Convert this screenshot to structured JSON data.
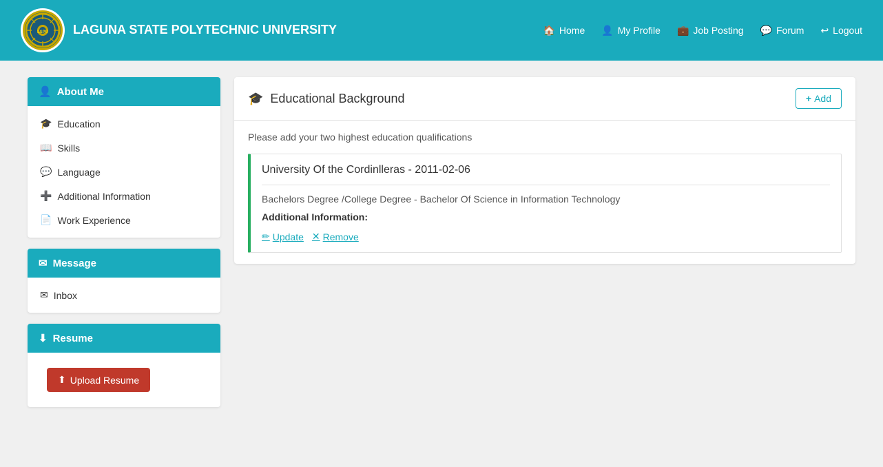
{
  "header": {
    "university_name": "LAGUNA STATE POLYTECHNIC UNIVERSITY",
    "nav": {
      "home": "Home",
      "my_profile": "My Profile",
      "job_posting": "Job Posting",
      "forum": "Forum",
      "logout": "Logout"
    }
  },
  "sidebar": {
    "about_me": {
      "label": "About Me",
      "items": [
        {
          "id": "education",
          "label": "Education",
          "icon": "grad-cap"
        },
        {
          "id": "skills",
          "label": "Skills",
          "icon": "book"
        },
        {
          "id": "language",
          "label": "Language",
          "icon": "chat"
        },
        {
          "id": "additional-info",
          "label": "Additional Information",
          "icon": "plus-icon"
        },
        {
          "id": "work-experience",
          "label": "Work Experience",
          "icon": "file-icon"
        }
      ]
    },
    "message": {
      "label": "Message",
      "items": [
        {
          "id": "inbox",
          "label": "Inbox",
          "icon": "envelope"
        }
      ]
    },
    "resume": {
      "label": "Resume",
      "upload_btn_label": "Upload Resume"
    }
  },
  "main": {
    "section_title": "Educational Background",
    "add_button": "Add",
    "info_text": "Please add your two highest education qualifications",
    "education_entry": {
      "university": "University Of the Cordinlleras - 2011-02-06",
      "degree": "Bachelors Degree /College Degree - Bachelor Of Science in Information Technology",
      "additional_label": "Additional Information:",
      "update_link": "Update",
      "remove_link": "Remove"
    }
  }
}
